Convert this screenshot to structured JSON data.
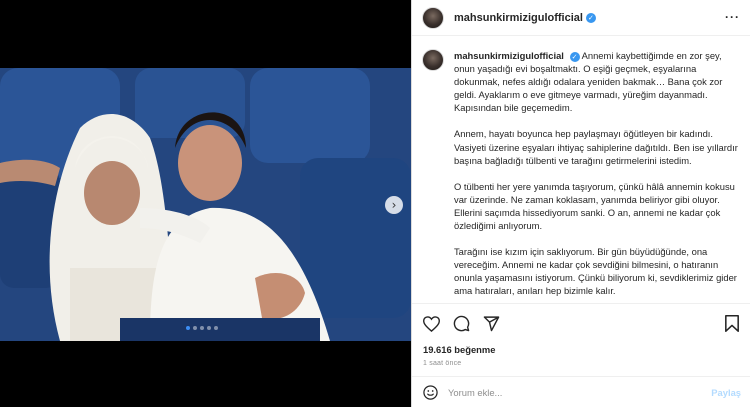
{
  "post": {
    "username": "mahsunkirmizigulofficial",
    "verified_mark": "✓",
    "more_icon": "more-horizontal-icon",
    "caption": [
      "Annemi kaybettiğimde en zor şey, onun yaşadığı evi boşaltmaktı. O eşiği geçmek, eşyalarına dokunmak, nefes aldığı odalara yeniden bakmak… Bana çok zor geldi. Ayaklarım o eve gitmeye varmadı, yüreğim dayanmadı. Kapısından bile geçemedim.",
      "Annem, hayatı boyunca hep paylaşmayı öğütleyen bir kadındı. Vasiyeti üzerine eşyaları ihtiyaç sahiplerine dağıtıldı. Ben ise yıllardır başına bağladığı tülbenti ve tarağını getirmelerini istedim.",
      "O tülbenti her yere yanımda taşıyorum, çünkü hâlâ annemin kokusu var üzerinde. Ne zaman koklasam, yanımda beliriyor gibi oluyor. Ellerini saçımda hissediyorum sanki. O an, annemi ne kadar çok özlediğimi anlıyorum.",
      "Tarağını ise kızım için saklıyorum. Bir gün büyüdüğünde, ona vereceğim. Annemi ne kadar çok sevdiğini bilmesini, o hatıranın onunla yaşamasını istiyorum. Çünkü biliyorum ki, sevdiklerimiz gider ama hatıraları, anıları hep bizimle kalır."
    ],
    "likes": "19.616 beğenme",
    "time_ago": "1 saat önce",
    "carousel": {
      "next_glyph": "›",
      "total_slides": 5,
      "current_slide": 1
    }
  },
  "comment": {
    "placeholder": "Yorum ekle...",
    "post_label": "Paylaş"
  },
  "colors": {
    "verified_blue": "#3897f0",
    "active_dot": "#3d8ff5"
  }
}
